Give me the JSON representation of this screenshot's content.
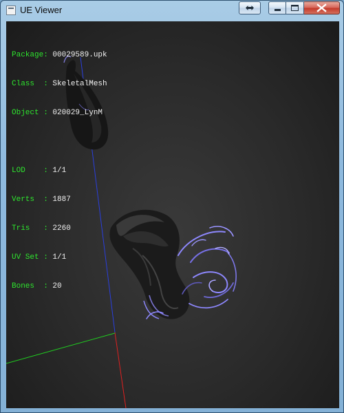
{
  "window": {
    "title": "UE Viewer"
  },
  "titlebar_controls": {
    "swap": "swap-arrows-icon",
    "minimize": "minimize-icon",
    "maximize": "maximize-icon",
    "close": "close-icon"
  },
  "info": {
    "package_key": "Package:",
    "package": "00029589.upk",
    "class_key": "Class  :",
    "class": "SkeletalMesh",
    "object_key": "Object :",
    "object": "020029_LynM",
    "lod_key": "LOD    :",
    "lod": "1/1",
    "verts_key": "Verts  :",
    "verts": "1887",
    "tris_key": "Tris   :",
    "tris": "2260",
    "uvset_key": "UV Set :",
    "uvset": "1/1",
    "bones_key": "Bones  :",
    "bones": "20"
  },
  "colors": {
    "label_green": "#2ee62e",
    "value_white": "#f2f2f2",
    "axis_x": "#e02020",
    "axis_y": "#20d020",
    "axis_z": "#2040e0",
    "hair_highlight": "#8e88ff"
  }
}
